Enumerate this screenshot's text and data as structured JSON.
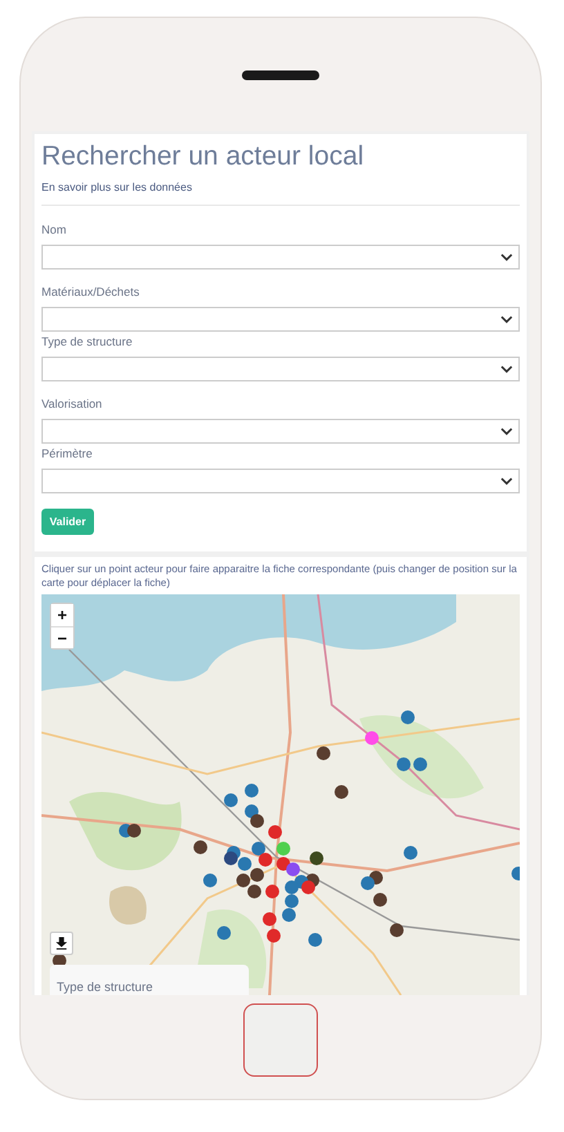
{
  "title": "Rechercher un acteur local",
  "info_link": "En savoir plus sur les données",
  "filters": [
    {
      "label": "Nom"
    },
    {
      "label": "Matériaux/Déchets"
    },
    {
      "label": "Type de structure"
    },
    {
      "label": "Valorisation"
    },
    {
      "label": "Périmètre"
    }
  ],
  "submit_button": "Valider",
  "map_hint": "Cliquer sur un point acteur pour faire apparaitre la fiche correspondante (puis changer de position sur la carte pour déplacer la fiche)",
  "map": {
    "zoom_in": "+",
    "zoom_out": "−",
    "legend_title": "Type de structure",
    "markers": [
      {
        "color": "#2a78b0"
      },
      {
        "color": "#ff4de8"
      },
      {
        "color": "#5a3e30"
      },
      {
        "color": "#2a78b0"
      },
      {
        "color": "#2a78b0"
      },
      {
        "color": "#2a78b0"
      },
      {
        "color": "#5a3e30"
      },
      {
        "color": "#2a78b0"
      },
      {
        "color": "#2a78b0"
      },
      {
        "color": "#5a3e30"
      },
      {
        "color": "#2a78b0"
      },
      {
        "color": "#5a3e30"
      },
      {
        "color": "#e02a2a"
      },
      {
        "color": "#5a3e30"
      },
      {
        "color": "#2a78b0"
      },
      {
        "color": "#4fd04f"
      },
      {
        "color": "#2c4a80"
      },
      {
        "color": "#2a78b0"
      },
      {
        "color": "#2a78b0"
      },
      {
        "color": "#e02a2a"
      },
      {
        "color": "#e02a2a"
      },
      {
        "color": "#8a4df0"
      },
      {
        "color": "#5a3e30"
      },
      {
        "color": "#5a3e30"
      },
      {
        "color": "#5a3e30"
      },
      {
        "color": "#2a78b0"
      },
      {
        "color": "#5a3e30"
      },
      {
        "color": "#3e4a1e"
      },
      {
        "color": "#2a78b0"
      },
      {
        "color": "#2a78b0"
      },
      {
        "color": "#2a78b0"
      },
      {
        "color": "#e02a2a"
      },
      {
        "color": "#e02a2a"
      },
      {
        "color": "#2a78b0"
      },
      {
        "color": "#5a3e30"
      },
      {
        "color": "#2a78b0"
      },
      {
        "color": "#5a3e30"
      },
      {
        "color": "#5a3e30"
      },
      {
        "color": "#2a78b0"
      },
      {
        "color": "#e02a2a"
      },
      {
        "color": "#e02a2a"
      },
      {
        "color": "#2a78b0"
      },
      {
        "color": "#2a78b0"
      },
      {
        "color": "#5a3e30"
      },
      {
        "color": "#2a78b0"
      }
    ]
  }
}
